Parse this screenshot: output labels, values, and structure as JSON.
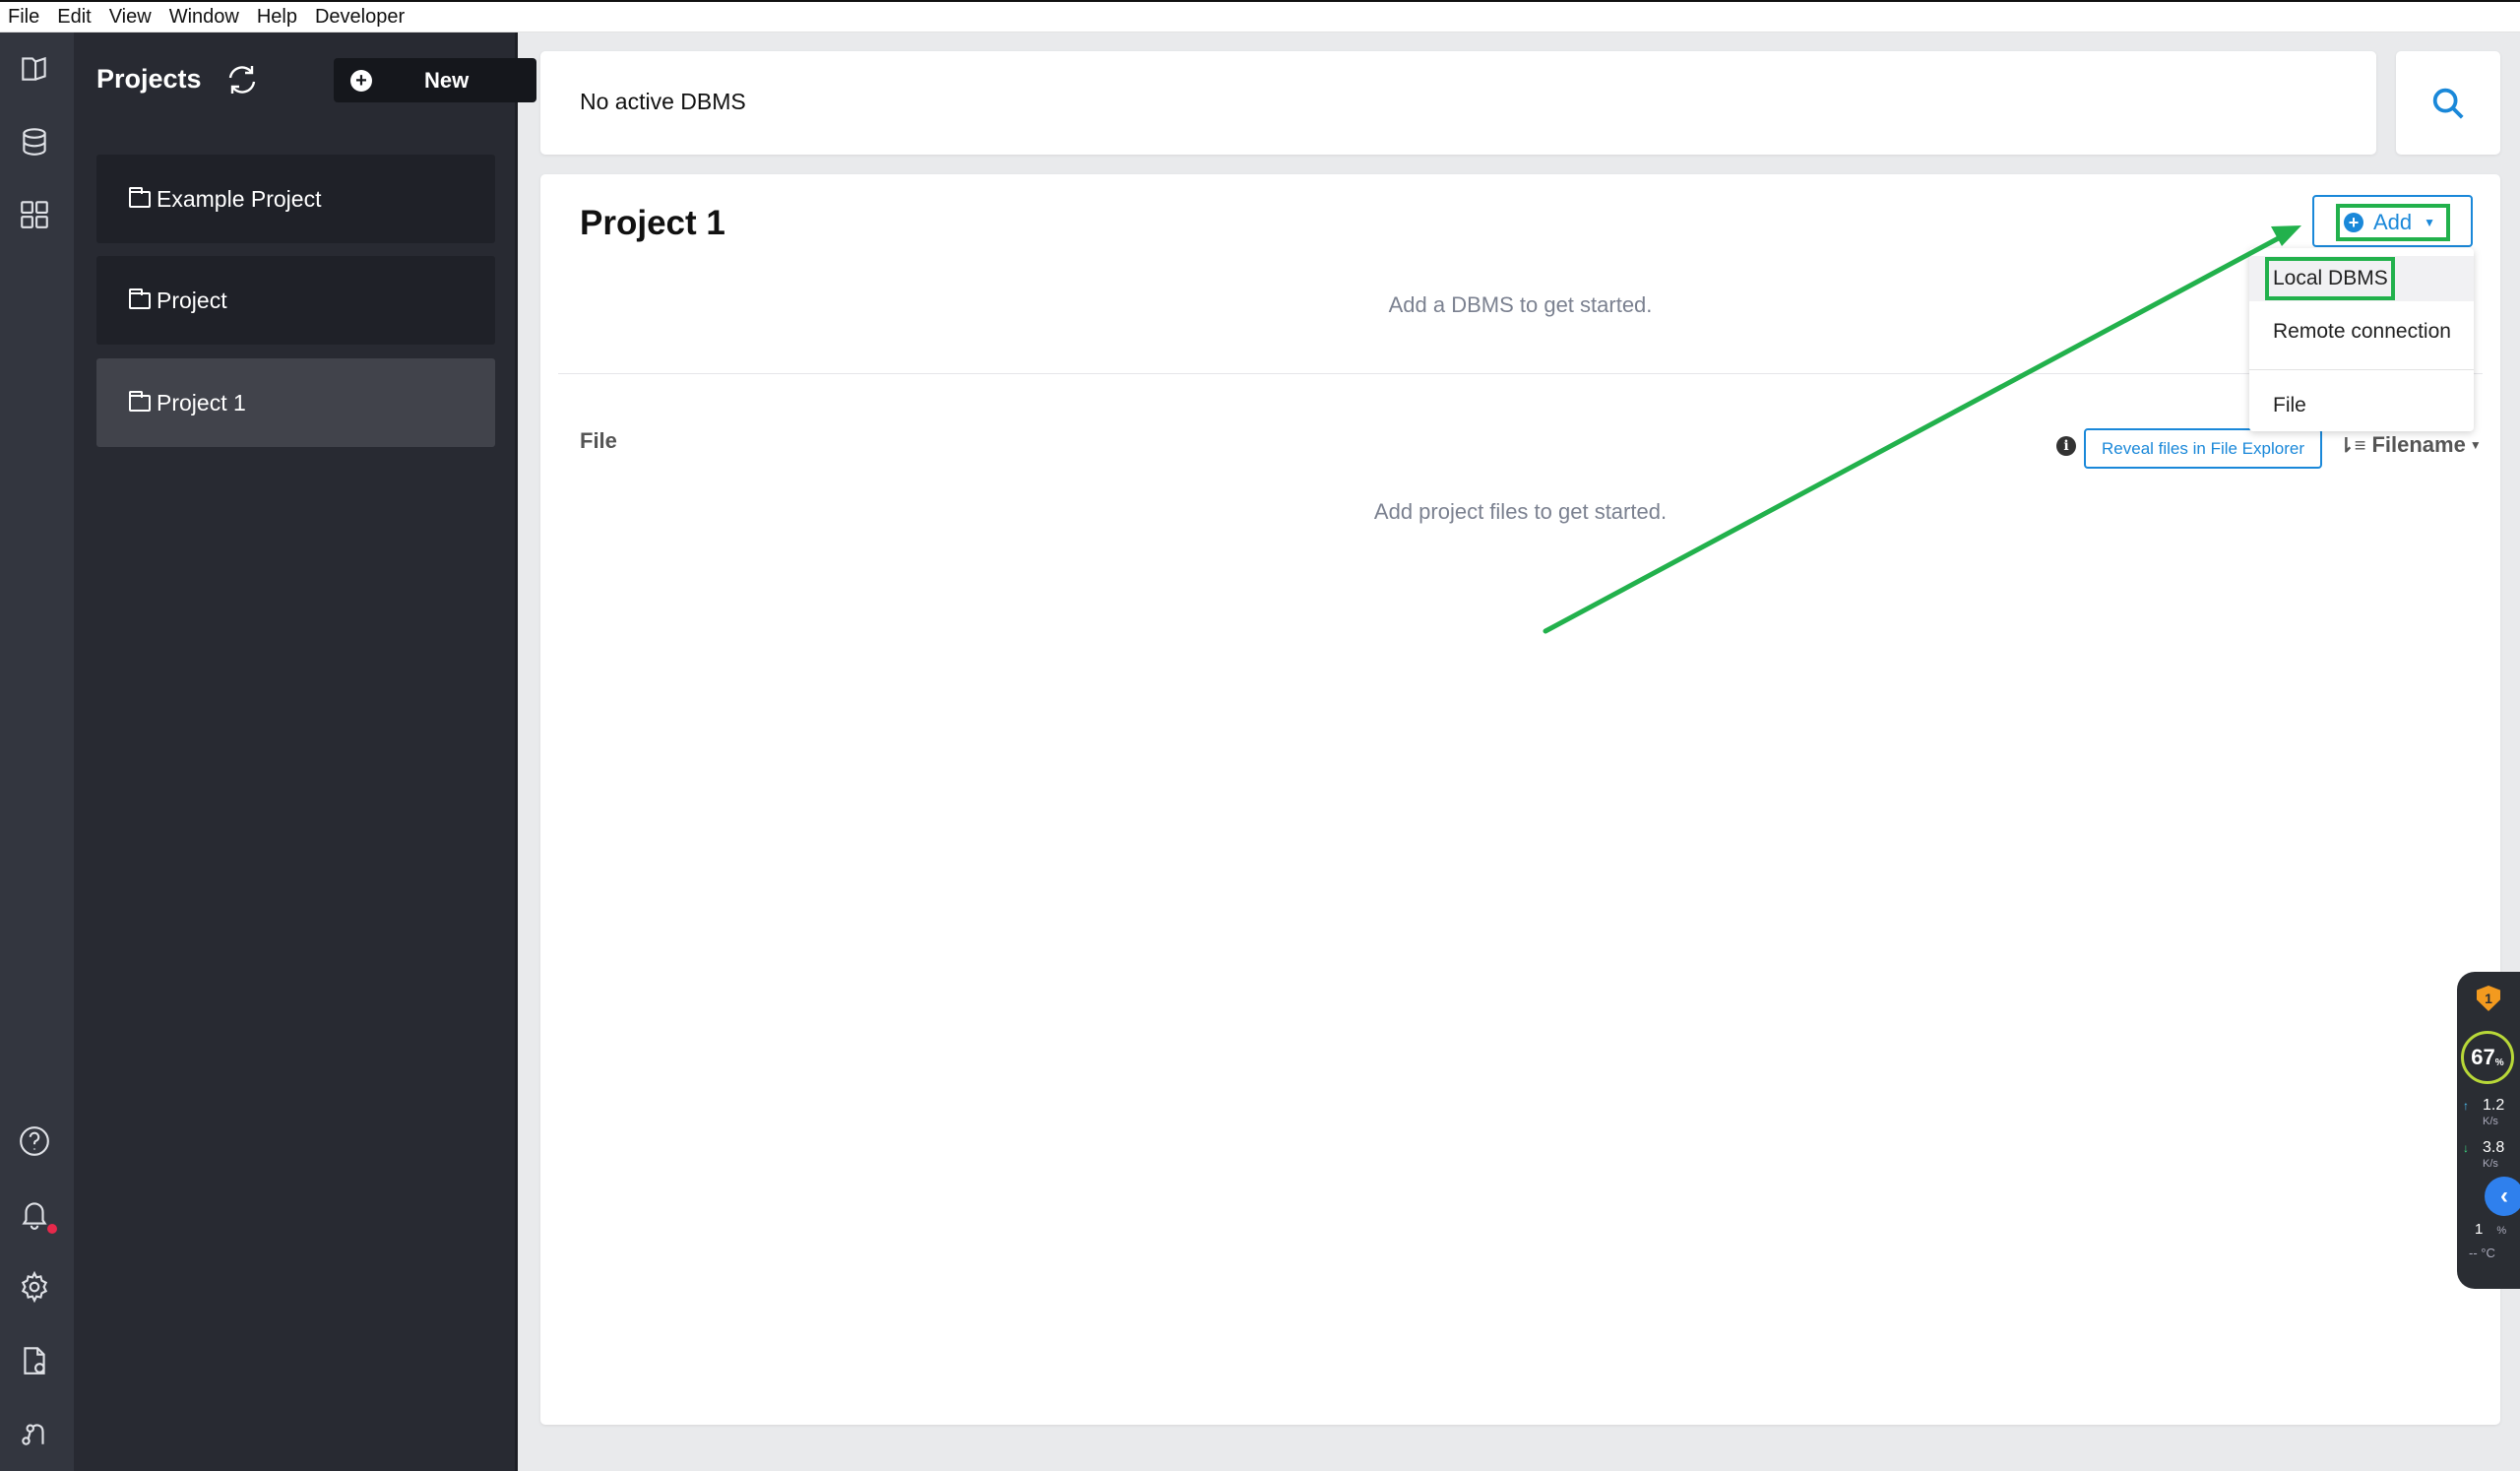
{
  "menu": [
    "File",
    "Edit",
    "View",
    "Window",
    "Help",
    "Developer"
  ],
  "rail": {
    "top_icons": [
      "projects-icon",
      "database-icon",
      "apps-grid-icon"
    ],
    "bottom_icons": [
      "help-icon",
      "bell-icon",
      "gear-icon",
      "file-check-icon",
      "graph-icon"
    ],
    "notification_dot_color": "#e6294b"
  },
  "projects_panel": {
    "title": "Projects",
    "new_label": "New",
    "items": [
      {
        "label": "Example Project",
        "active": false
      },
      {
        "label": "Project",
        "active": false
      },
      {
        "label": "Project 1",
        "active": true
      }
    ]
  },
  "topbar": {
    "status": "No active DBMS"
  },
  "main": {
    "title": "Project 1",
    "add_label": "Add",
    "dbms_hint": "Add a DBMS to get started.",
    "file_section_label": "File",
    "reveal_label": "Reveal files in File Explorer",
    "sort_label": "Filename",
    "files_hint": "Add project files to get started.",
    "dropdown": [
      "Local DBMS",
      "Remote connection",
      "File"
    ]
  },
  "widget": {
    "shield_count": "1",
    "gauge_value": "67",
    "gauge_unit": "%",
    "upload_value": "1.2",
    "upload_unit": "K/s",
    "download_value": "3.8",
    "download_unit": "K/s",
    "cpu_value": "1",
    "cpu_unit": "%",
    "temp": "-- °C"
  },
  "colors": {
    "accent": "#1a88d9",
    "annotation_green": "#22b14c",
    "rail_bg": "#33363f",
    "panel_bg": "#282a32"
  }
}
